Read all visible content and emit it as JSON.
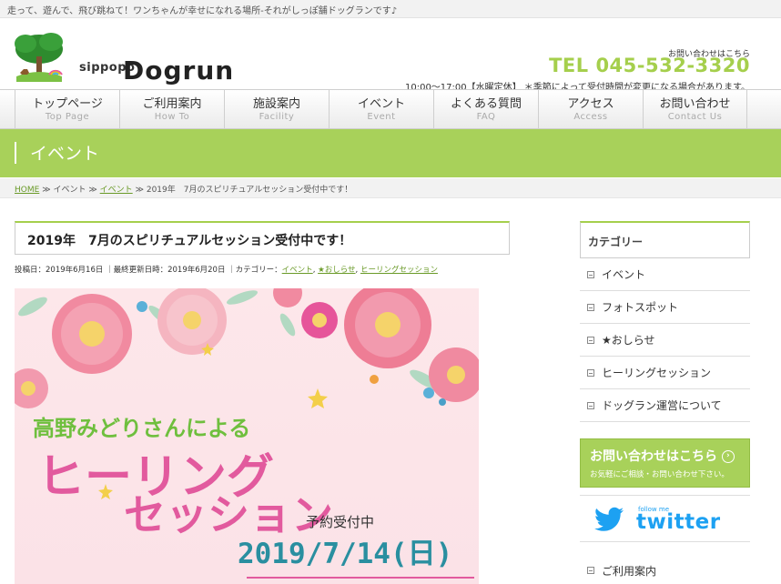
{
  "topbar": {
    "tagline": "走って、遊んで、飛び跳ねて！ワンちゃんが幸せになれる場所-それがしっぽ舗ドッグランです♪"
  },
  "header": {
    "logo_sub": "sippopo",
    "logo_main": "Dogrun",
    "contact_small": "お問い合わせはこちら",
    "tel": "TEL 045-532-3320",
    "hours": "10:00～17:00【水曜定休】 ＊季節によって受付時間が変更になる場合があります。"
  },
  "nav": [
    {
      "ja": "トップページ",
      "en": "Top Page"
    },
    {
      "ja": "ご利用案内",
      "en": "How To"
    },
    {
      "ja": "施設案内",
      "en": "Facility"
    },
    {
      "ja": "イベント",
      "en": "Event"
    },
    {
      "ja": "よくある質問",
      "en": "FAQ"
    },
    {
      "ja": "アクセス",
      "en": "Access"
    },
    {
      "ja": "お問い合わせ",
      "en": "Contact Us"
    }
  ],
  "banner": {
    "title": "イベント"
  },
  "breadcrumb": {
    "home": "HOME",
    "sep": "≫",
    "item1": "イベント",
    "item2": "イベント",
    "current": "2019年　7月のスピリチュアルセッション受付中です！"
  },
  "post": {
    "title": "2019年　7月のスピリチュアルセッション受付中です！",
    "posted_label": "投稿日：",
    "posted": "2019年6月16日",
    "updated_label": "｜最終更新日時：",
    "updated": "2019年6月20日",
    "category_label": "｜カテゴリー：",
    "categories": [
      "イベント",
      "★おしらせ",
      "ヒーリングセッション"
    ]
  },
  "hero": {
    "line1": "高野みどりさんによる",
    "line2": "ヒーリング",
    "line3": "セッション",
    "reserve": "予約受付中",
    "date": "2019/7/14(日)"
  },
  "sidebar": {
    "heading": "カテゴリー",
    "items": [
      "イベント",
      "フォトスポット",
      "★おしらせ",
      "ヒーリングセッション",
      "ドッグラン運営について"
    ],
    "cta_main": "お問い合わせはこちら",
    "cta_sub": "お気軽にご相談・お問い合わせ下さい。",
    "twitter_small": "follow me",
    "twitter_word": "twitter",
    "bottom_item": "ご利用案内"
  },
  "colors": {
    "accent": "#a8d15a",
    "tel": "#a5cf4c",
    "twitter": "#1da1f2",
    "pink": "#e25a9e",
    "teal": "#2a8fa0"
  }
}
